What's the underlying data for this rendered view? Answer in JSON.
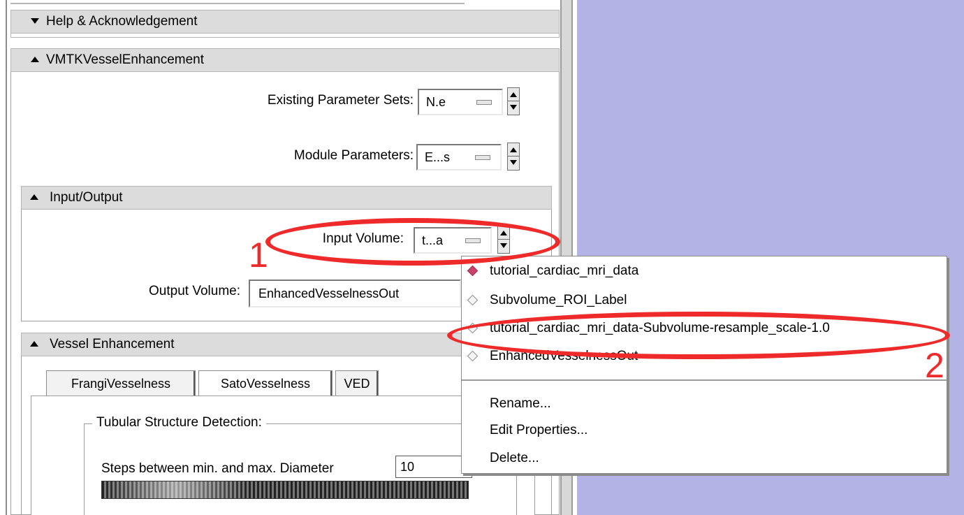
{
  "sections": {
    "help": "Help & Acknowledgement",
    "module": "VMTKVesselEnhancement",
    "io": "Input/Output",
    "vessel": "Vessel Enhancement"
  },
  "module_params": {
    "existing_label": "Existing Parameter Sets:",
    "existing_value": "N.e",
    "params_label": "Module Parameters:",
    "params_value": "E...s"
  },
  "io": {
    "input_label": "Input Volume:",
    "input_value": "t...a",
    "output_label": "Output Volume:",
    "output_value": "EnhancedVesselnessOut"
  },
  "tabs": [
    "FrangiVesselness",
    "SatoVesselness",
    "VED"
  ],
  "tubular": {
    "group_label": "Tubular Structure Detection:",
    "steps_label": "Steps between min. and max. Diameter",
    "steps_value": "10"
  },
  "popup_menu": {
    "volumes": [
      {
        "label": "tutorial_cardiac_mri_data",
        "selected": true
      },
      {
        "label": "Subvolume_ROI_Label",
        "selected": false
      },
      {
        "label": "tutorial_cardiac_mri_data-Subvolume-resample_scale-1.0",
        "selected": false
      },
      {
        "label": "EnhancedVesselnessOut",
        "selected": false
      }
    ],
    "commands": [
      "Rename...",
      "Edit Properties...",
      "Delete..."
    ]
  },
  "annotations": {
    "step1": "1",
    "step2": "2",
    "color": "#ee2a2a"
  },
  "colors": {
    "view_background": "#b3b3e6",
    "header_bg": "#dcdcdc"
  }
}
